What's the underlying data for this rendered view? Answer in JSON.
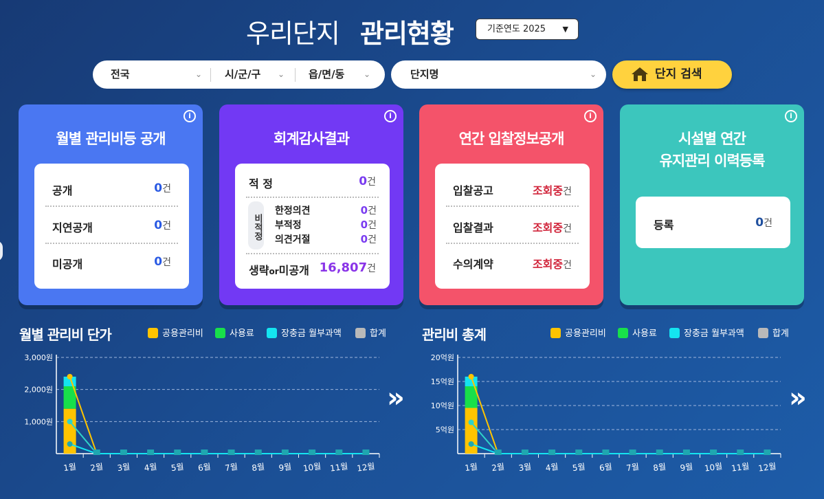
{
  "header": {
    "title_light": "우리단지",
    "title_bold": "관리현황",
    "year_select": "기준연도 2025"
  },
  "search": {
    "sido": "전국",
    "sigungu": "시/군/구",
    "eupmyeondong": "읍/면/동",
    "complex_name": "단지명",
    "button": "단지 검색"
  },
  "cards": {
    "monthly": {
      "title": "월별 관리비등 공개",
      "rows": [
        {
          "label": "공개",
          "value": "0",
          "unit": "건"
        },
        {
          "label": "지연공개",
          "value": "0",
          "unit": "건"
        },
        {
          "label": "미공개",
          "value": "0",
          "unit": "건"
        }
      ]
    },
    "audit": {
      "title": "회계감사결과",
      "proper_label": "적 정",
      "proper_value": "0",
      "improper_tag": "비적정",
      "improper_rows": [
        {
          "label": "한정의견",
          "value": "0",
          "unit": "건"
        },
        {
          "label": "부적정",
          "value": "0",
          "unit": "건"
        },
        {
          "label": "의견거절",
          "value": "0",
          "unit": "건"
        }
      ],
      "omit_label_a": "생략",
      "omit_label_or": "or",
      "omit_label_b": "미공개",
      "omit_value": "16,807",
      "unit": "건"
    },
    "bid": {
      "title": "연간 입찰정보공개",
      "rows": [
        {
          "label": "입찰공고",
          "value": "조회중",
          "unit": "건"
        },
        {
          "label": "입찰결과",
          "value": "조회중",
          "unit": "건"
        },
        {
          "label": "수의계약",
          "value": "조회중",
          "unit": "건"
        }
      ]
    },
    "facility": {
      "title_line1": "시설별 연간",
      "title_line2": "유지관리 이력등록",
      "row_label": "등록",
      "row_value": "0",
      "unit": "건"
    },
    "info_icon": "i"
  },
  "legend": {
    "common": "공용관리비",
    "usage": "사용료",
    "reserve": "장충금 월부과액",
    "total": "합계"
  },
  "colors": {
    "common": "#ffc400",
    "usage": "#18e04a",
    "reserve": "#14e4f0",
    "total": "#b9b9b9"
  },
  "chart_data": [
    {
      "type": "bar",
      "title": "월별 관리비 단가",
      "categories": [
        "1월",
        "2월",
        "3월",
        "4월",
        "5월",
        "6월",
        "7월",
        "8월",
        "9월",
        "10월",
        "11월",
        "12월"
      ],
      "y_ticks": [
        "1,000원",
        "2,000원",
        "3,000원"
      ],
      "ylim": [
        0,
        3000
      ],
      "series": [
        {
          "name": "공용관리비",
          "values": [
            1400,
            0,
            0,
            0,
            0,
            0,
            0,
            0,
            0,
            0,
            0,
            0
          ]
        },
        {
          "name": "사용료",
          "values": [
            700,
            0,
            0,
            0,
            0,
            0,
            0,
            0,
            0,
            0,
            0,
            0
          ]
        },
        {
          "name": "장충금 월부과액",
          "values": [
            300,
            0,
            0,
            0,
            0,
            0,
            0,
            0,
            0,
            0,
            0,
            0
          ]
        },
        {
          "name": "합계",
          "values": [
            2400,
            0,
            0,
            0,
            0,
            0,
            0,
            0,
            0,
            0,
            0,
            0
          ]
        }
      ],
      "grid": true
    },
    {
      "type": "bar",
      "title": "관리비 총계",
      "categories": [
        "1월",
        "2월",
        "3월",
        "4월",
        "5월",
        "6월",
        "7월",
        "8월",
        "9월",
        "10월",
        "11월",
        "12월"
      ],
      "y_ticks": [
        "5억원",
        "10억원",
        "15억원",
        "20억원"
      ],
      "ylim": [
        0,
        20
      ],
      "series": [
        {
          "name": "공용관리비",
          "values": [
            9.5,
            0,
            0,
            0,
            0,
            0,
            0,
            0,
            0,
            0,
            0,
            0
          ]
        },
        {
          "name": "사용료",
          "values": [
            4.5,
            0,
            0,
            0,
            0,
            0,
            0,
            0,
            0,
            0,
            0,
            0
          ]
        },
        {
          "name": "장충금 월부과액",
          "values": [
            2,
            0,
            0,
            0,
            0,
            0,
            0,
            0,
            0,
            0,
            0,
            0
          ]
        },
        {
          "name": "합계",
          "values": [
            16,
            0,
            0,
            0,
            0,
            0,
            0,
            0,
            0,
            0,
            0,
            0
          ]
        }
      ],
      "grid": true
    }
  ],
  "nav_arrow": "»"
}
